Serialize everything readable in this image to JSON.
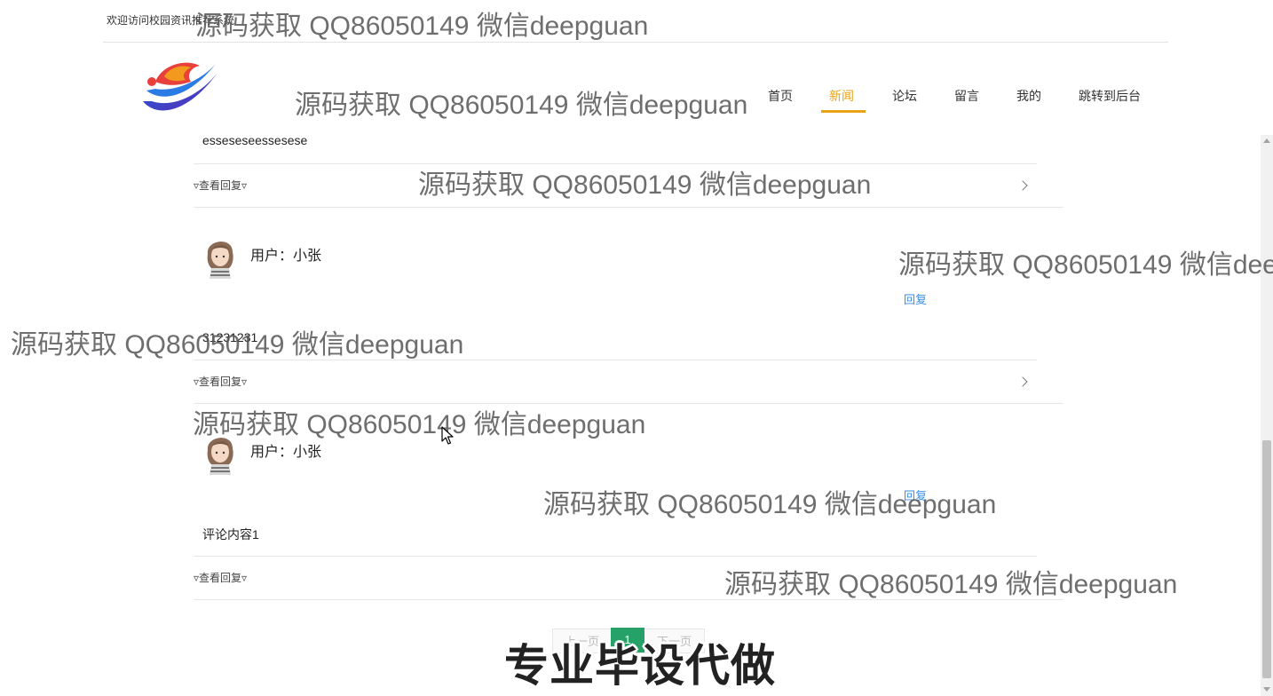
{
  "header": {
    "welcome": "欢迎访问校园资讯推荐系统"
  },
  "nav": {
    "items": [
      {
        "label": "首页",
        "active": false
      },
      {
        "label": "新闻",
        "active": true
      },
      {
        "label": "论坛",
        "active": false
      },
      {
        "label": "留言",
        "active": false
      },
      {
        "label": "我的",
        "active": false
      },
      {
        "label": "跳转到后台",
        "active": false
      }
    ],
    "accent_color": "#e8a317"
  },
  "comments": [
    {
      "username": "",
      "content": "esseseseessesese",
      "view_replies": "▿查看回复▿",
      "reply": ""
    },
    {
      "username": "用户：小张",
      "content": "31231231",
      "view_replies": "▿查看回复▿",
      "reply": "回复"
    },
    {
      "username": "用户：小张",
      "content": "评论内容1",
      "view_replies": "▿查看回复▿",
      "reply": "回复"
    }
  ],
  "pagination": {
    "prev": "上一页",
    "current": "1",
    "next": "下一页",
    "current_color": "#26a269"
  },
  "watermarks": {
    "text": "源码获取 QQ86050149 微信deepguan",
    "banner": "专业毕设代做"
  },
  "icons": {
    "logo": "flame-logo",
    "chevron": "chevron-right-icon",
    "cursor": "mouse-pointer-icon"
  }
}
